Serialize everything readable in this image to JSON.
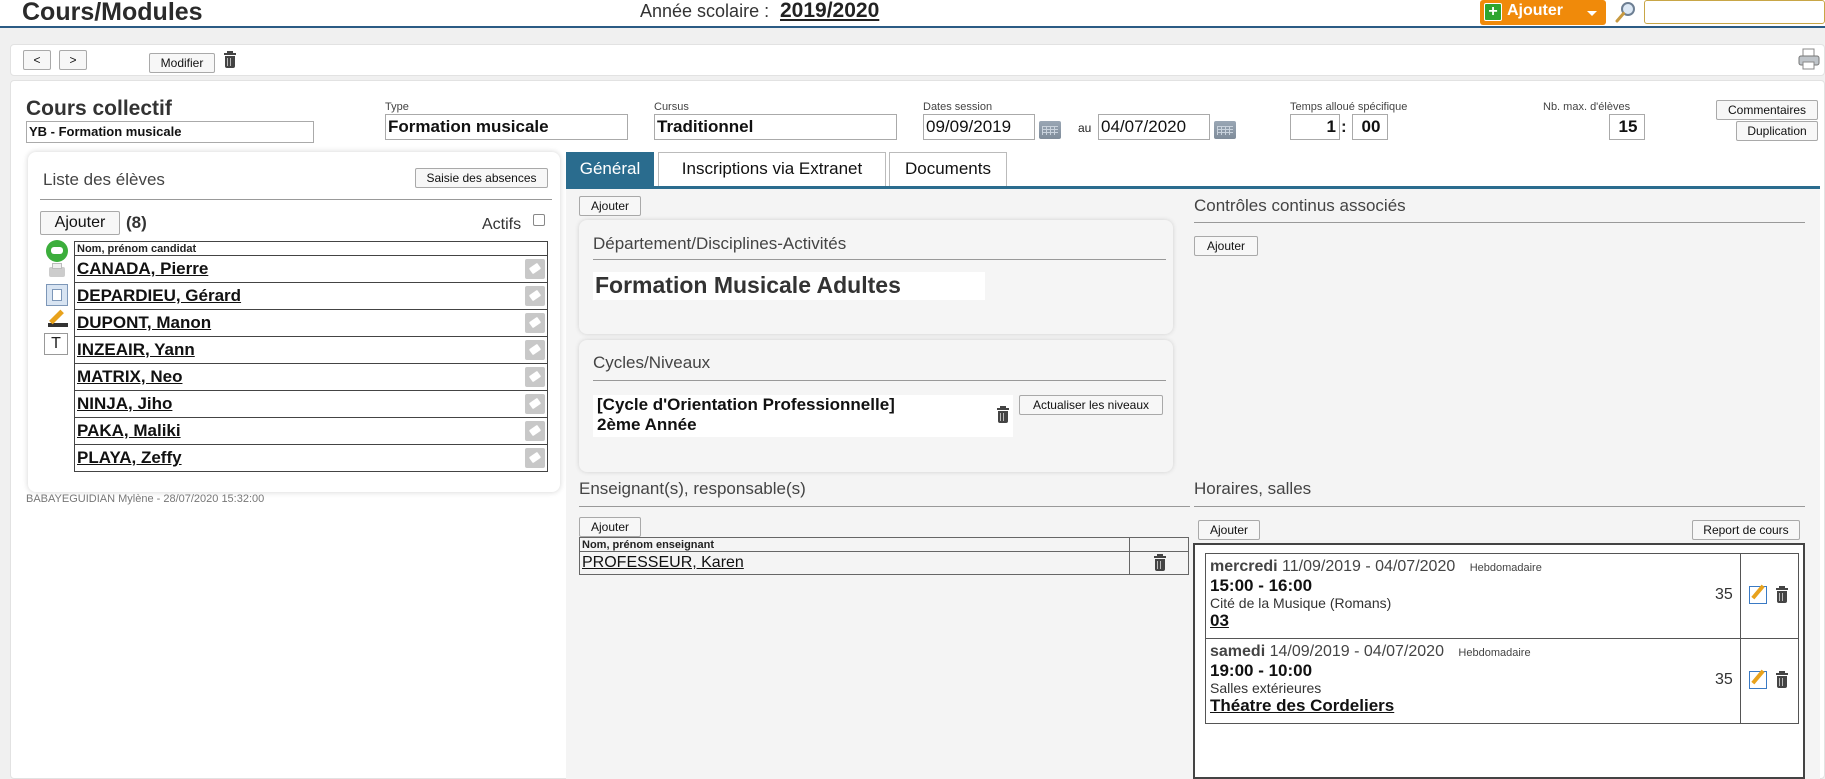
{
  "header": {
    "title": "Cours/Modules",
    "year_label": "Année scolaire :",
    "year_value": "2019/2020",
    "add_button": "Ajouter"
  },
  "toolbar": {
    "prev": "<",
    "next": ">",
    "modify": "Modifier"
  },
  "course": {
    "heading": "Cours collectif",
    "name": "YB - Formation musicale",
    "type_label": "Type",
    "type_value": "Formation musicale",
    "cursus_label": "Cursus",
    "cursus_value": "Traditionnel",
    "dates_label": "Dates session",
    "date_start": "09/09/2019",
    "date_sep": "au",
    "date_end": "04/07/2020",
    "time_label": "Temps alloué spécifique",
    "time_hours": "1",
    "time_sep": ":",
    "time_minutes": "00",
    "max_label": "Nb. max. d'élèves",
    "max_value": "15",
    "comments_button": "Commentaires",
    "duplicate_button": "Duplication"
  },
  "students": {
    "title": "Liste des élèves",
    "absences_button": "Saisie des absences",
    "add_button": "Ajouter",
    "count": "(8)",
    "active_label": "Actifs",
    "column_header": "Nom, prénom candidat",
    "rows": [
      "CANADA, Pierre",
      "DEPARDIEU, Gérard",
      "DUPONT, Manon",
      "INZEAIR, Yann",
      "MATRIX, Neo",
      "NINJA, Jiho",
      "PAKA, Maliki",
      "PLAYA, Zeffy"
    ],
    "side_text_icon": "T"
  },
  "footer_note": "BABAYEGUIDIAN Mylène - 28/07/2020 15:32:00",
  "tabs": [
    "Général",
    "Inscriptions via Extranet",
    "Documents"
  ],
  "general": {
    "add_button": "Ajouter",
    "department_title": "Département/Disciplines-Activités",
    "department_value": "Formation Musicale Adultes",
    "cycles_title": "Cycles/Niveaux",
    "cycle_line1": "[Cycle d'Orientation Professionnelle]",
    "cycle_line2": "2ème Année",
    "update_levels_button": "Actualiser les niveaux",
    "controls_title": "Contrôles continus associés",
    "controls_add": "Ajouter",
    "teachers_title": "Enseignant(s), responsable(s)",
    "teachers_add": "Ajouter",
    "teachers_header": "Nom, prénom enseignant",
    "teacher_name": "PROFESSEUR, Karen",
    "schedule_title": "Horaires, salles",
    "schedule_add": "Ajouter",
    "report_button": "Report de cours",
    "sessions": [
      {
        "day": "mercredi",
        "dates": "11/09/2019 - 04/07/2020",
        "freq": "Hebdomadaire",
        "time": "15:00 - 16:00",
        "place": "Cité de la Musique (Romans)",
        "room": "03",
        "count": "35"
      },
      {
        "day": "samedi",
        "dates": "14/09/2019 - 04/07/2020",
        "freq": "Hebdomadaire",
        "time": "19:00 - 10:00",
        "place": "Salles extérieures",
        "room": "Théatre des Cordeliers",
        "count": "35"
      }
    ]
  },
  "colors": {
    "accent": "#2a6c8e",
    "add_orange": "#f08a0a",
    "header_line": "#2b5b84"
  }
}
